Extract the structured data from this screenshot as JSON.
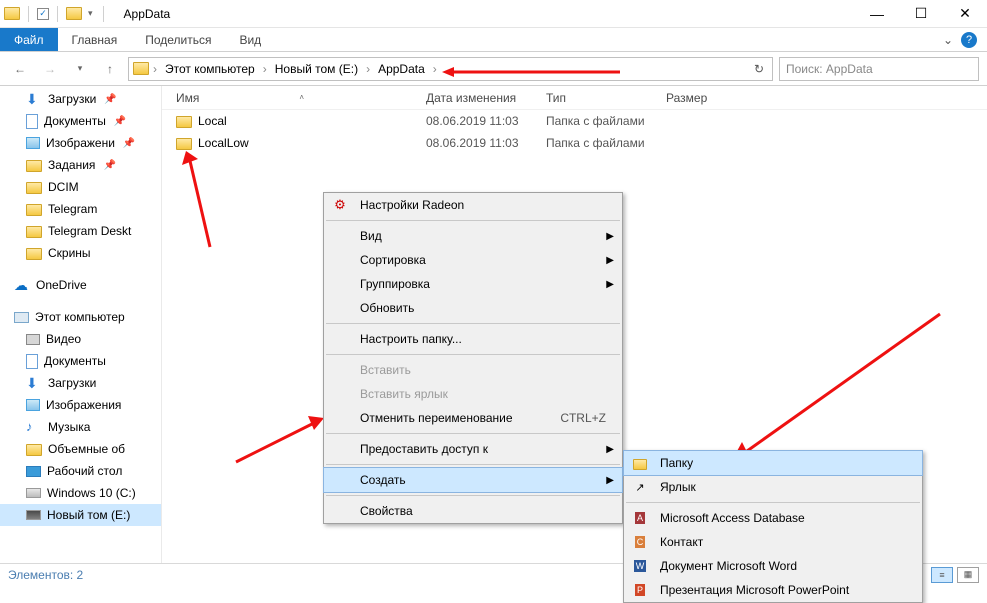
{
  "window": {
    "title": "AppData"
  },
  "ribbon": {
    "file": "Файл",
    "tabs": [
      "Главная",
      "Поделиться",
      "Вид"
    ]
  },
  "breadcrumb": [
    "Этот компьютер",
    "Новый том (E:)",
    "AppData"
  ],
  "search_placeholder": "Поиск: AppData",
  "columns": {
    "name": "Имя",
    "date": "Дата изменения",
    "type": "Тип",
    "size": "Размер"
  },
  "files": [
    {
      "name": "Local",
      "date": "08.06.2019 11:03",
      "type": "Папка с файлами"
    },
    {
      "name": "LocalLow",
      "date": "08.06.2019 11:03",
      "type": "Папка с файлами"
    }
  ],
  "tree": {
    "quick": [
      {
        "label": "Загрузки",
        "icon": "dl",
        "pin": true
      },
      {
        "label": "Документы",
        "icon": "doc",
        "pin": true
      },
      {
        "label": "Изображени",
        "icon": "img",
        "pin": true
      },
      {
        "label": "Задания",
        "icon": "folder",
        "pin": true
      },
      {
        "label": "DCIM",
        "icon": "folder"
      },
      {
        "label": "Telegram",
        "icon": "folder"
      },
      {
        "label": "Telegram Deskt",
        "icon": "folder"
      },
      {
        "label": "Скрины",
        "icon": "folder"
      }
    ],
    "onedrive": "OneDrive",
    "thispc": "Этот компьютер",
    "pc": [
      {
        "label": "Видео",
        "icon": "vid"
      },
      {
        "label": "Документы",
        "icon": "doc"
      },
      {
        "label": "Загрузки",
        "icon": "dl"
      },
      {
        "label": "Изображения",
        "icon": "img"
      },
      {
        "label": "Музыка",
        "icon": "music"
      },
      {
        "label": "Объемные об",
        "icon": "folder"
      },
      {
        "label": "Рабочий стол",
        "icon": "desk"
      },
      {
        "label": "Windows 10 (C:)",
        "icon": "drive"
      },
      {
        "label": "Новый том (E:)",
        "icon": "drive-sel",
        "selected": true
      }
    ]
  },
  "status": "Элементов: 2",
  "ctx1": [
    {
      "label": "Настройки Radeon",
      "icon": "radeon"
    },
    {
      "sep": true
    },
    {
      "label": "Вид",
      "sub": true
    },
    {
      "label": "Сортировка",
      "sub": true
    },
    {
      "label": "Группировка",
      "sub": true
    },
    {
      "label": "Обновить"
    },
    {
      "sep": true
    },
    {
      "label": "Настроить папку..."
    },
    {
      "sep": true
    },
    {
      "label": "Вставить",
      "disabled": true
    },
    {
      "label": "Вставить ярлык",
      "disabled": true
    },
    {
      "label": "Отменить переименование",
      "shortcut": "CTRL+Z"
    },
    {
      "sep": true
    },
    {
      "label": "Предоставить доступ к",
      "sub": true
    },
    {
      "sep": true
    },
    {
      "label": "Создать",
      "sub": true,
      "hover": true
    },
    {
      "sep": true
    },
    {
      "label": "Свойства"
    }
  ],
  "ctx2": [
    {
      "label": "Папку",
      "icon": "folder",
      "hover": true
    },
    {
      "label": "Ярлык",
      "icon": "shortcut"
    },
    {
      "sep": true
    },
    {
      "label": "Microsoft Access Database",
      "icon": "access"
    },
    {
      "label": "Контакт",
      "icon": "contact"
    },
    {
      "label": "Документ Microsoft Word",
      "icon": "word"
    },
    {
      "label": "Презентация Microsoft PowerPoint",
      "icon": "ppt"
    }
  ]
}
